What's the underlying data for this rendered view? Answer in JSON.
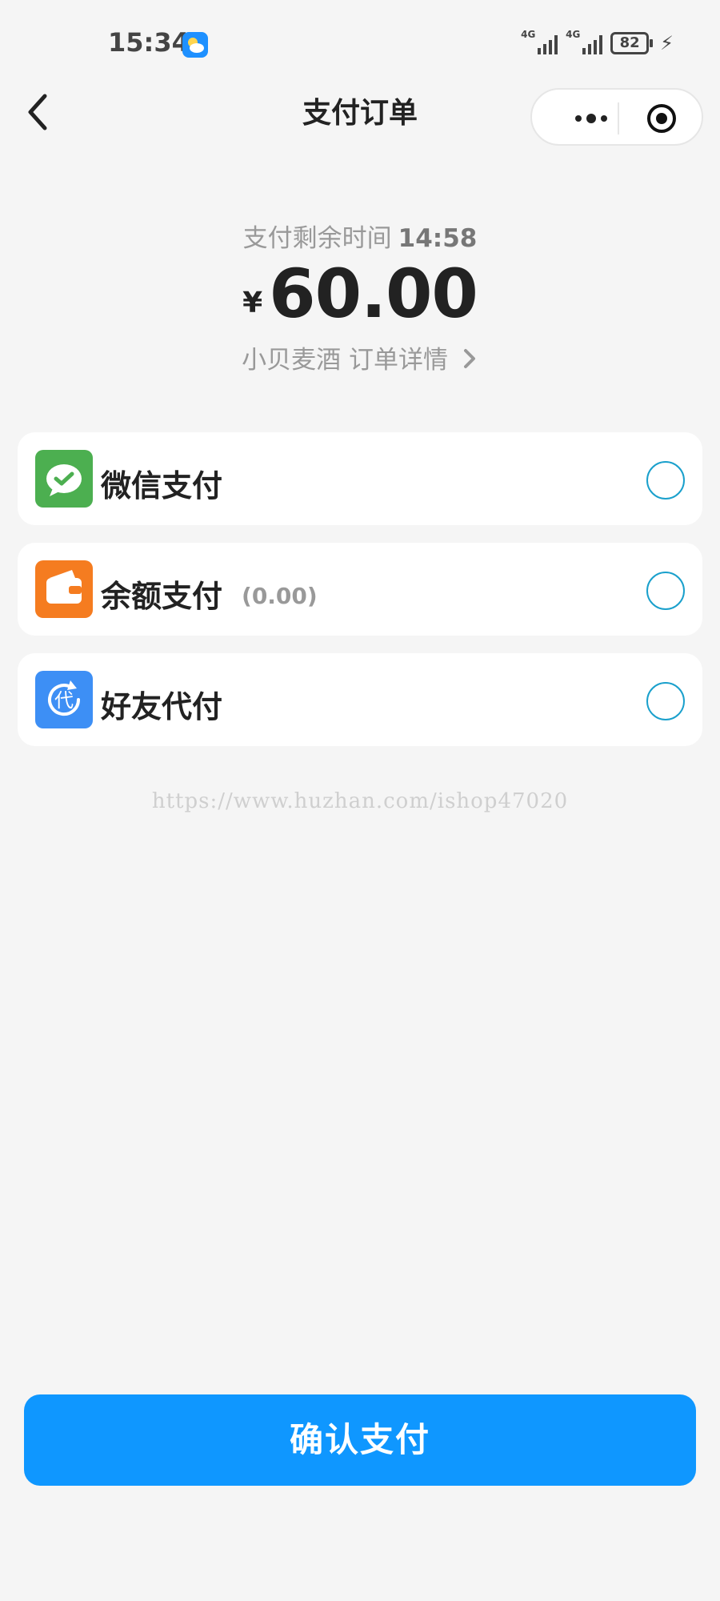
{
  "status_bar": {
    "time": "15:34",
    "signal_1": "4G",
    "signal_2": "4G",
    "battery": "82",
    "weather_icon": "weather-icon"
  },
  "nav": {
    "title": "支付订单",
    "back_icon": "chevron-left-icon",
    "more_icon": "more-dots-icon",
    "close_icon": "target-icon"
  },
  "order": {
    "remaining_label": "支付剩余时间",
    "countdown": "14:58",
    "currency": "¥",
    "amount": "60.00",
    "merchant": "小贝麦酒",
    "detail_link": "订单详情"
  },
  "payment_methods": [
    {
      "label": "微信支付",
      "sub": "",
      "icon": "wechat-icon",
      "color": "#4caf50",
      "selected": false
    },
    {
      "label": "余额支付",
      "sub": "(0.00)",
      "icon": "wallet-icon",
      "color": "#f57c20",
      "selected": false
    },
    {
      "label": "好友代付",
      "sub": "",
      "icon": "proxy-pay-icon",
      "color": "#3d8ff5",
      "selected": false
    }
  ],
  "watermark": "https://www.huzhan.com/ishop47020",
  "confirm_button": {
    "label": "确认支付",
    "color": "#0f97ff"
  }
}
